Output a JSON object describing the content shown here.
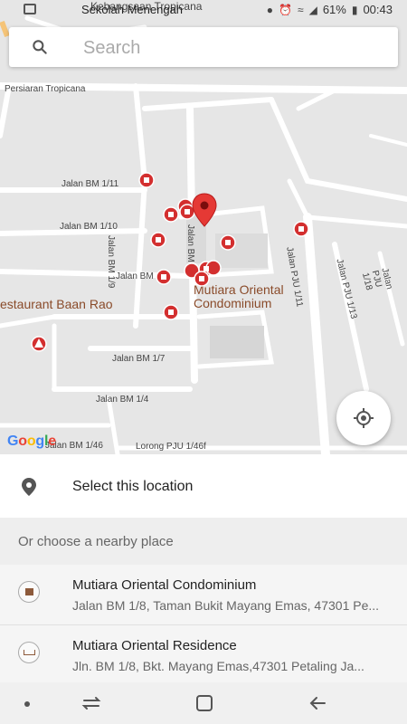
{
  "status_bar": {
    "notification_text": "Sekolah Menengah",
    "battery": "61%",
    "time": "00:43"
  },
  "search": {
    "placeholder": "Search"
  },
  "map": {
    "top_label": "Kebangsaan Tropicana",
    "road_labels": {
      "persiaran": "Persiaran Tropicana",
      "bm1_11": "Jalan BM 1/11",
      "bm1_10": "Jalan BM 1/10",
      "bm1_9": "Jalan BM 1/9",
      "bm1_8": "Jalan BM 1/8",
      "bm1_1": "Jalan BM 1/1",
      "bm1_7": "Jalan BM 1/7",
      "bm1_4": "Jalan BM 1/4",
      "bm1_46": "Jalan BM 1/46",
      "pju1_46f": "Lorong PJU 1/46f",
      "pju1_11": "Jalan PJU 1/11",
      "pju1_13": "Jalan PJU 1/13",
      "pju1_18": "Jalan PJU 1/18"
    },
    "place_labels": {
      "restaurant": "estaurant Baan Rao",
      "condo_line1": "Mutiara Oriental",
      "condo_line2": "Condominium"
    },
    "google": "Google"
  },
  "select_location": {
    "label": "Select this location"
  },
  "nearby": {
    "header": "Or choose a nearby place",
    "places": [
      {
        "title": "Mutiara Oriental Condominium",
        "address": "Jalan BM 1/8, Taman Bukit Mayang Emas, 47301 Pe..."
      },
      {
        "title": "Mutiara Oriental Residence",
        "address": "Jln. BM 1/8, Bkt. Mayang Emas,47301 Petaling Ja..."
      }
    ]
  },
  "colors": {
    "map_bg": "#e6e6e6",
    "road": "#ffffff",
    "marker_red": "#d32f2f",
    "poi_label": "#8a4b2a"
  }
}
